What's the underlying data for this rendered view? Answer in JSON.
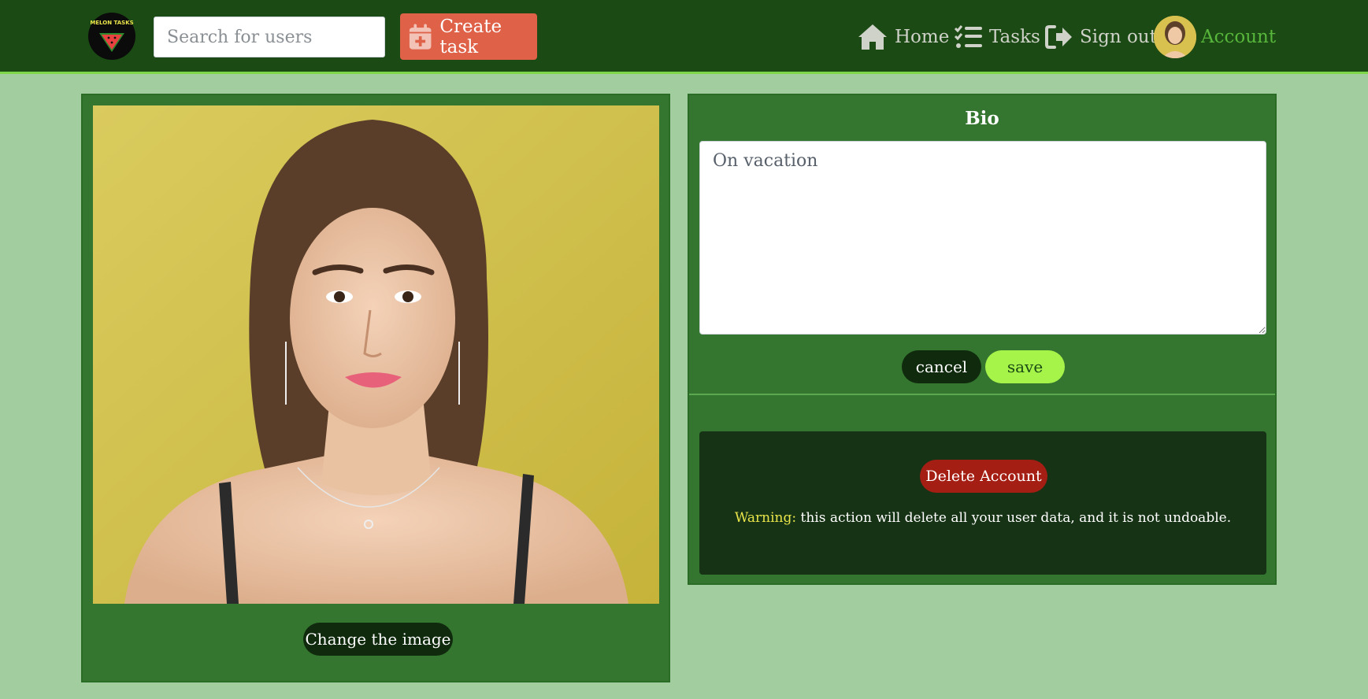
{
  "header": {
    "logo_text": "MELON TASKS",
    "search_placeholder": "Search for users",
    "create_task_label": "Create task",
    "nav": {
      "home": "Home",
      "tasks": "Tasks",
      "sign_out": "Sign out",
      "account": "Account"
    }
  },
  "profile": {
    "change_image_label": "Change the image"
  },
  "bio": {
    "title": "Bio",
    "text": "On vacation",
    "cancel_label": "cancel",
    "save_label": "save"
  },
  "danger": {
    "delete_label": "Delete Account",
    "warning_prefix": "Warning:",
    "warning_text": " this action will delete all your user data, and it is not undoable."
  },
  "colors": {
    "header_bg": "#1b4a14",
    "page_bg": "#a2cd9e",
    "card_bg": "#34762f",
    "create_button": "#de6148",
    "save_button": "#a6f44a",
    "delete_button": "#a51e14",
    "account_link": "#57b63b"
  },
  "icons": [
    "house-icon",
    "tasks-checklist-icon",
    "sign-out-icon",
    "calendar-plus-icon"
  ]
}
